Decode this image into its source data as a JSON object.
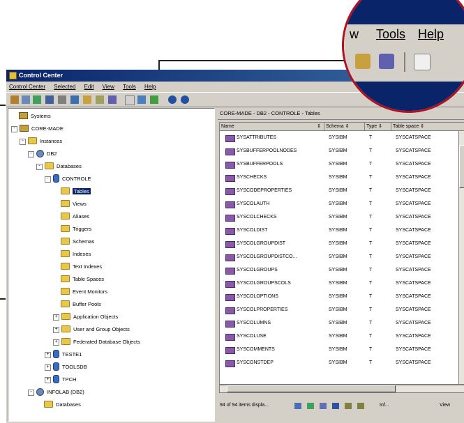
{
  "window": {
    "title": "Control Center",
    "menu": [
      "Control Center",
      "Selected",
      "Edit",
      "View",
      "Tools",
      "Help"
    ]
  },
  "magnifier": {
    "menu": [
      "w",
      "Tools",
      "Help"
    ]
  },
  "tree": [
    {
      "label": "Systems",
      "type": "sysic",
      "depth": 0,
      "expander": "none"
    },
    {
      "label": "CORE-MADE",
      "type": "sysic",
      "depth": 0,
      "expander": "-"
    },
    {
      "label": "Instances",
      "type": "folder",
      "depth": 1,
      "expander": "-"
    },
    {
      "label": "DB2",
      "type": "instic",
      "depth": 2,
      "expander": "-"
    },
    {
      "label": "Databases",
      "type": "folder",
      "depth": 3,
      "expander": "-"
    },
    {
      "label": "CONTROLE",
      "type": "dbic",
      "depth": 4,
      "expander": "-"
    },
    {
      "label": "Tables",
      "type": "folder",
      "depth": 5,
      "expander": "none",
      "selected": true
    },
    {
      "label": "Views",
      "type": "folder",
      "depth": 5,
      "expander": "none"
    },
    {
      "label": "Aliases",
      "type": "folder",
      "depth": 5,
      "expander": "none"
    },
    {
      "label": "Triggers",
      "type": "folder",
      "depth": 5,
      "expander": "none"
    },
    {
      "label": "Schemas",
      "type": "folder",
      "depth": 5,
      "expander": "none"
    },
    {
      "label": "Indexes",
      "type": "folder",
      "depth": 5,
      "expander": "none"
    },
    {
      "label": "Text Indexes",
      "type": "folder",
      "depth": 5,
      "expander": "none"
    },
    {
      "label": "Table Spaces",
      "type": "folder",
      "depth": 5,
      "expander": "none"
    },
    {
      "label": "Event Monitors",
      "type": "folder",
      "depth": 5,
      "expander": "none"
    },
    {
      "label": "Buffer Pools",
      "type": "folder",
      "depth": 5,
      "expander": "none"
    },
    {
      "label": "Application Objects",
      "type": "folder",
      "depth": 5,
      "expander": "+"
    },
    {
      "label": "User and Group Objects",
      "type": "folder",
      "depth": 5,
      "expander": "+"
    },
    {
      "label": "Federated Database Objects",
      "type": "folder",
      "depth": 5,
      "expander": "+"
    },
    {
      "label": "TESTE1",
      "type": "dbic",
      "depth": 4,
      "expander": "+"
    },
    {
      "label": "TOOLSDB",
      "type": "dbic",
      "depth": 4,
      "expander": "+"
    },
    {
      "label": "TPCH",
      "type": "dbic",
      "depth": 4,
      "expander": "+"
    },
    {
      "label": "INFOLAB (DB2)",
      "type": "instic",
      "depth": 2,
      "expander": "-"
    },
    {
      "label": "Databases",
      "type": "folder",
      "depth": 3,
      "expander": "none"
    }
  ],
  "panel": {
    "title": "CORE-MADE - DB2 - CONTROLE - Tables",
    "columns": [
      "Name",
      "Schema",
      "Type",
      "Table space"
    ],
    "rows": [
      [
        "SYSATTRIBUTES",
        "SYSIBM",
        "T",
        "SYSCATSPACE"
      ],
      [
        "SYSBUFFERPOOLNODES",
        "SYSIBM",
        "T",
        "SYSCATSPACE"
      ],
      [
        "SYSBUFFERPOOLS",
        "SYSIBM",
        "T",
        "SYSCATSPACE"
      ],
      [
        "SYSCHECKS",
        "SYSIBM",
        "T",
        "SYSCATSPACE"
      ],
      [
        "SYSCODEPROPERTIES",
        "SYSIBM",
        "T",
        "SYSCATSPACE"
      ],
      [
        "SYSCOLAUTH",
        "SYSIBM",
        "T",
        "SYSCATSPACE"
      ],
      [
        "SYSCOLCHECKS",
        "SYSIBM",
        "T",
        "SYSCATSPACE"
      ],
      [
        "SYSCOLDIST",
        "SYSIBM",
        "T",
        "SYSCATSPACE"
      ],
      [
        "SYSCOLGROUPDIST",
        "SYSIBM",
        "T",
        "SYSCATSPACE"
      ],
      [
        "SYSCOLGROUPDISTCO...",
        "SYSIBM",
        "T",
        "SYSCATSPACE"
      ],
      [
        "SYSCOLGROUPS",
        "SYSIBM",
        "T",
        "SYSCATSPACE"
      ],
      [
        "SYSCOLGROUPSCOLS",
        "SYSIBM",
        "T",
        "SYSCATSPACE"
      ],
      [
        "SYSCOLOPTIONS",
        "SYSIBM",
        "T",
        "SYSCATSPACE"
      ],
      [
        "SYSCOLPROPERTIES",
        "SYSIBM",
        "T",
        "SYSCATSPACE"
      ],
      [
        "SYSCOLUMNS",
        "SYSIBM",
        "T",
        "SYSCATSPACE"
      ],
      [
        "SYSCOLUSE",
        "SYSIBM",
        "T",
        "SYSCATSPACE"
      ],
      [
        "SYSCOMMENTS",
        "SYSIBM",
        "T",
        "SYSCATSPACE"
      ],
      [
        "SYSCONSTDEP",
        "SYSIBM",
        "T",
        "SYSCATSPACE"
      ]
    ],
    "status": "94 of 94 items displa...",
    "filter_label": "Inf...",
    "view_label": "View"
  },
  "colors": {
    "accent": "#b01020",
    "titlebar": "#0a246a",
    "window": "#d4d0c8"
  }
}
